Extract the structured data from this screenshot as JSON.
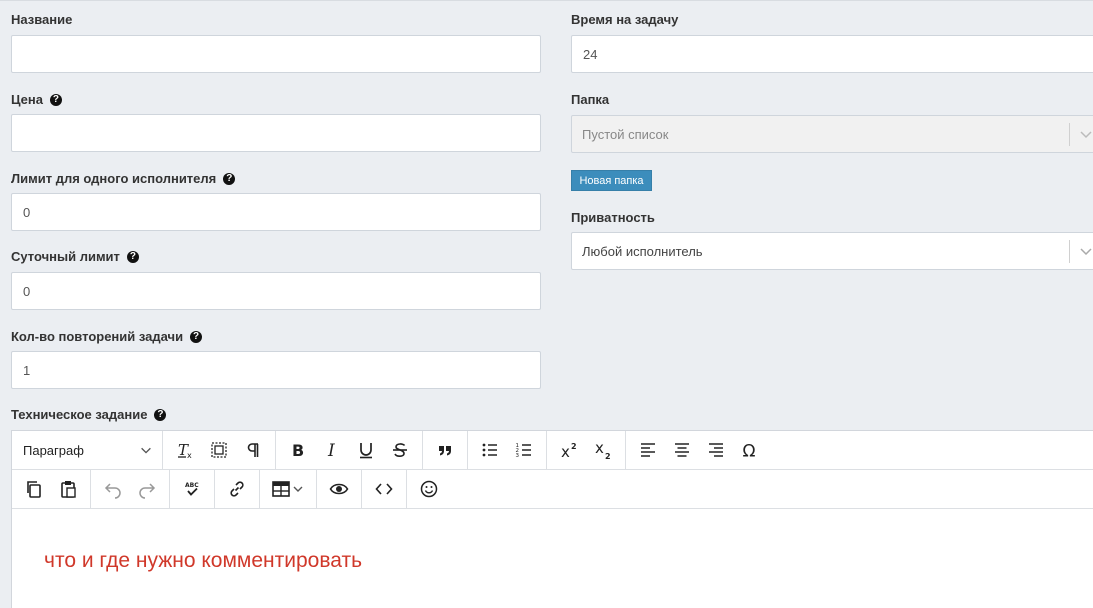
{
  "form": {
    "name": {
      "label": "Название",
      "value": ""
    },
    "time": {
      "label": "Время на задачу",
      "value": "24"
    },
    "price": {
      "label": "Цена",
      "value": ""
    },
    "folder": {
      "label": "Папка",
      "value": "Пустой список"
    },
    "new_folder_button": "Новая папка",
    "limit_per_executor": {
      "label": "Лимит для одного исполнителя",
      "value": "0"
    },
    "privacy": {
      "label": "Приватность",
      "value": "Любой исполнитель"
    },
    "daily_limit": {
      "label": "Суточный лимит",
      "value": "0"
    },
    "repeats": {
      "label": "Кол-во повторений задачи",
      "value": "1"
    },
    "spec": {
      "label": "Техническое задание"
    }
  },
  "editor": {
    "block_format": "Параграф",
    "content": "что и где нужно комментировать"
  },
  "colors": {
    "accent": "#3c8dbc",
    "content_text": "#d0382a",
    "background": "#ebeef2"
  }
}
